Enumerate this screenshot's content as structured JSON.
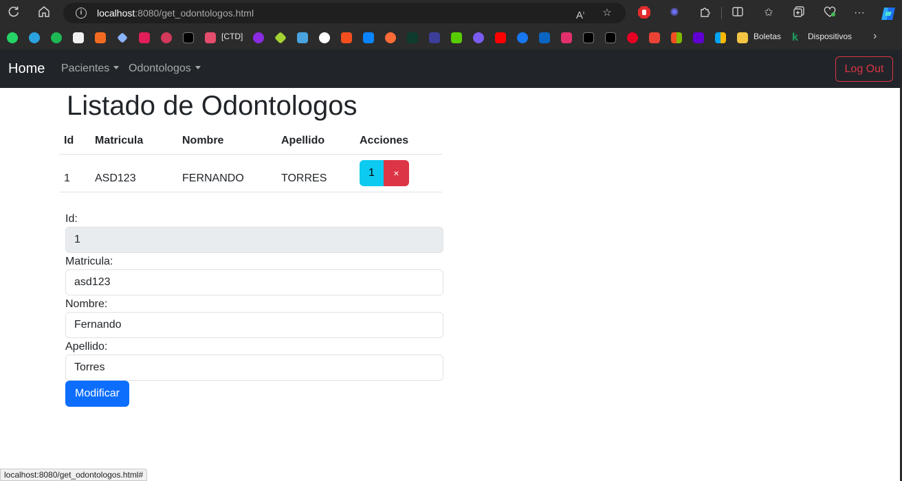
{
  "browser": {
    "url_host": "localhost",
    "url_path": ":8080/get_odontologos.html",
    "bookmarks": {
      "ctd_label": "[CTD]",
      "boletas_label": "Boletas",
      "dispositivos_label": "Dispositivos"
    },
    "status_url": "localhost:8080/get_odontologos.html#"
  },
  "navbar": {
    "brand": "Home",
    "menu": [
      {
        "label": "Pacientes"
      },
      {
        "label": "Odontologos"
      }
    ],
    "logout_label": "Log Out"
  },
  "page": {
    "title": "Listado de Odontologos"
  },
  "table": {
    "headers": [
      "Id",
      "Matricula",
      "Nombre",
      "Apellido",
      "Acciones"
    ],
    "rows": [
      {
        "id": "1",
        "matricula": "ASD123",
        "nombre": "FERNANDO",
        "apellido": "TORRES",
        "edit_label": "1",
        "delete_label": "×"
      }
    ]
  },
  "form": {
    "id_label": "Id:",
    "id_value": "1",
    "matricula_label": "Matricula:",
    "matricula_value": "asd123",
    "nombre_label": "Nombre:",
    "nombre_value": "Fernando",
    "apellido_label": "Apellido:",
    "apellido_value": "Torres",
    "submit_label": "Modificar"
  },
  "colors": {
    "navbar_bg": "#212529",
    "primary": "#0d6efd",
    "info": "#0dcaf0",
    "danger": "#dc3545"
  },
  "icons": {
    "browser_toolbar": [
      "refresh-icon",
      "home-icon",
      "info-icon",
      "read-aloud-icon",
      "favorite-star-icon",
      "adblock-icon",
      "extension-flower-icon",
      "extensions-icon",
      "split-screen-icon",
      "favorites-icon",
      "collections-icon",
      "health-icon",
      "more-icon",
      "copilot-icon"
    ]
  }
}
